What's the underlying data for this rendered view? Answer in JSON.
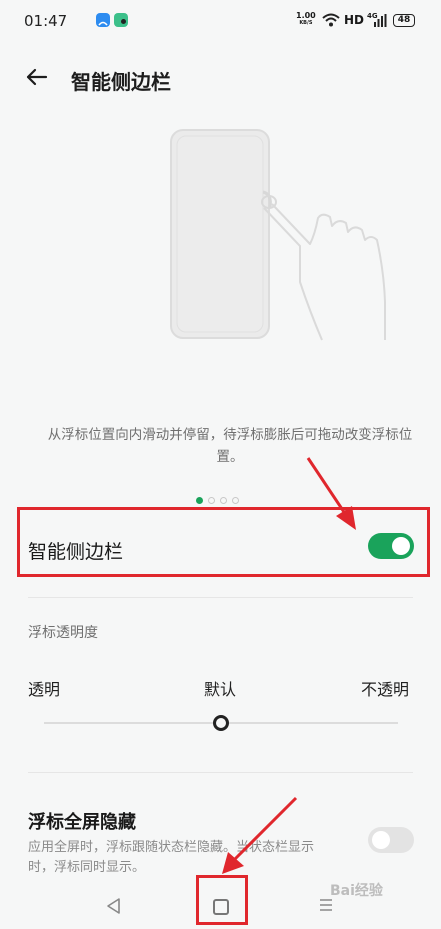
{
  "status_bar": {
    "time": "01:47",
    "network_speed_value": "1.00",
    "network_speed_unit": "KB/S",
    "hd_label": "HD",
    "signal_label": "4G",
    "battery": "48"
  },
  "header": {
    "title": "智能侧边栏"
  },
  "illustration": {
    "description": "从浮标位置向内滑动并停留，待浮标膨胀后可拖动改变浮标位置。",
    "page_index": 1,
    "page_count": 4
  },
  "smart_sidebar": {
    "label": "智能侧边栏",
    "enabled": true
  },
  "opacity": {
    "section_label": "浮标透明度",
    "left_label": "透明",
    "center_label": "默认",
    "right_label": "不透明",
    "value_fraction": 0.5
  },
  "fullscreen_hide": {
    "title": "浮标全屏隐藏",
    "description": "应用全屏时，浮标跟随状态栏隐藏。当状态栏显示时，浮标同时显示。",
    "enabled": false
  },
  "watermark": "Bai经验",
  "colors": {
    "accent": "#1aa35b",
    "annotation": "#e0272d",
    "background": "#f6f7f7"
  }
}
